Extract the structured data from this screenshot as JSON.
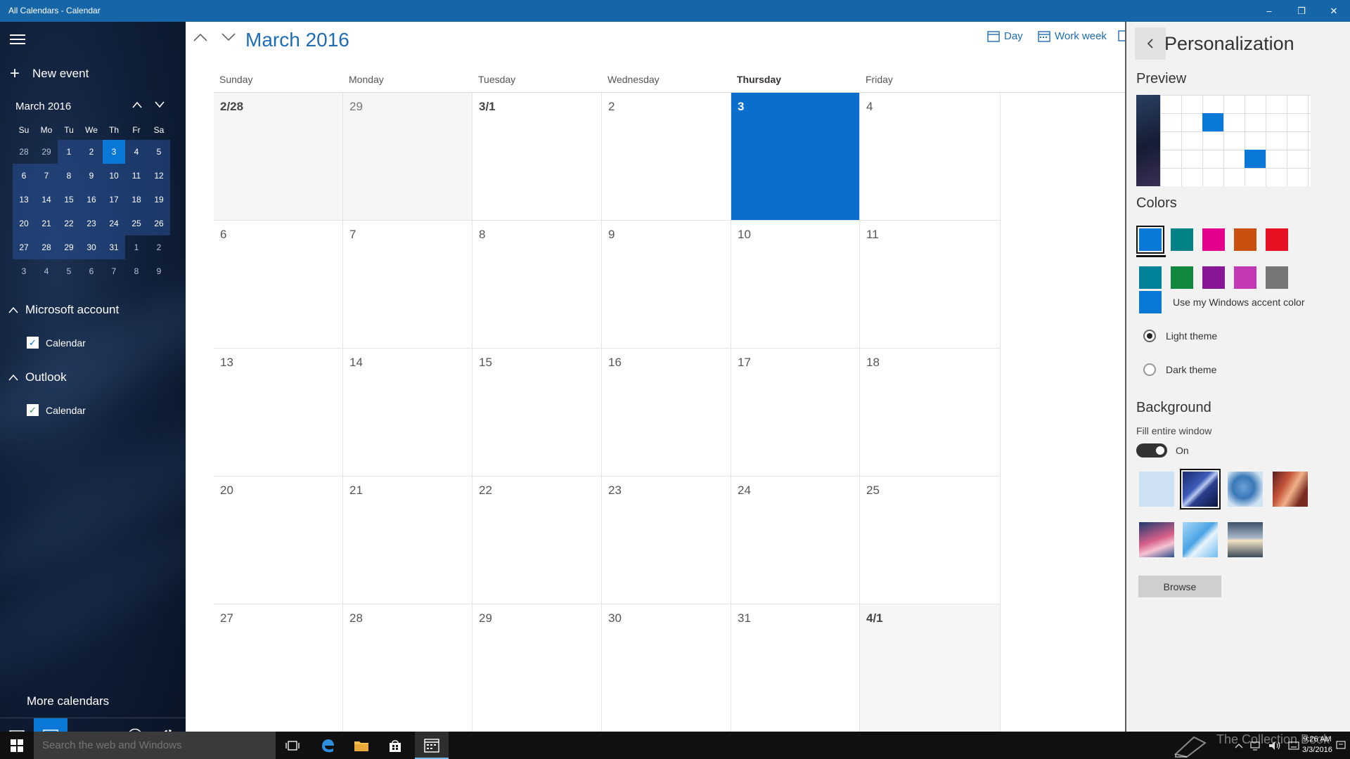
{
  "window": {
    "title": "All Calendars - Calendar",
    "controls": {
      "minimize": "–",
      "restore": "❐",
      "close": "✕"
    }
  },
  "sidebar": {
    "new_event_label": "New event",
    "mini_calendar": {
      "month_label": "March 2016",
      "weekday_headers": [
        "Su",
        "Mo",
        "Tu",
        "We",
        "Th",
        "Fr",
        "Sa"
      ],
      "weeks": [
        [
          "28",
          "29",
          "1",
          "2",
          "3",
          "4",
          "5"
        ],
        [
          "6",
          "7",
          "8",
          "9",
          "10",
          "11",
          "12"
        ],
        [
          "13",
          "14",
          "15",
          "16",
          "17",
          "18",
          "19"
        ],
        [
          "20",
          "21",
          "22",
          "23",
          "24",
          "25",
          "26"
        ],
        [
          "27",
          "28",
          "29",
          "30",
          "31",
          "1",
          "2"
        ],
        [
          "3",
          "4",
          "5",
          "6",
          "7",
          "8",
          "9"
        ]
      ],
      "today": "3"
    },
    "accounts": [
      {
        "name": "Microsoft account",
        "calendar": "Calendar",
        "color": "#0a78d7"
      },
      {
        "name": "Outlook",
        "calendar": "Calendar",
        "color": "#2c9a3c"
      }
    ],
    "more_calendars_label": "More calendars",
    "bottom_icons": [
      "mail-icon",
      "calendar-icon",
      "feedback-icon",
      "gear-icon"
    ]
  },
  "main": {
    "month_title": "March 2016",
    "views": [
      {
        "label": "Day",
        "icon": "day-view-icon"
      },
      {
        "label": "Work week",
        "icon": "work-week-icon"
      }
    ],
    "day_names": [
      "Sunday",
      "Monday",
      "Tuesday",
      "Wednesday",
      "Thursday",
      "Friday"
    ],
    "today_column": 4,
    "weeks": [
      [
        "2/28",
        "29",
        "3/1",
        "2",
        "3",
        "4"
      ],
      [
        "6",
        "7",
        "8",
        "9",
        "10",
        "11"
      ],
      [
        "13",
        "14",
        "15",
        "16",
        "17",
        "18"
      ],
      [
        "20",
        "21",
        "22",
        "23",
        "24",
        "25"
      ],
      [
        "27",
        "28",
        "29",
        "30",
        "31",
        "4/1"
      ]
    ]
  },
  "personalization": {
    "title": "Personalization",
    "preview_label": "Preview",
    "colors_label": "Colors",
    "colors_row1": [
      "#0a78d7",
      "#038387",
      "#e3008c",
      "#ca5010",
      "#e81123"
    ],
    "colors_row2": [
      "#008299",
      "#10893e",
      "#881798",
      "#c239b3",
      "#767676"
    ],
    "selected_color": "#0a78d7",
    "accent_label": "Use my Windows accent color",
    "theme_options": [
      {
        "label": "Light theme",
        "selected": true
      },
      {
        "label": "Dark theme",
        "selected": false
      }
    ],
    "background_label": "Background",
    "fill_label": "Fill entire window",
    "toggle_state": "On",
    "browse_label": "Browse"
  },
  "taskbar": {
    "search_placeholder": "Search the web and Windows",
    "watermark": "The Collection Book",
    "time": "9:26 AM",
    "date": "3/3/2016"
  }
}
